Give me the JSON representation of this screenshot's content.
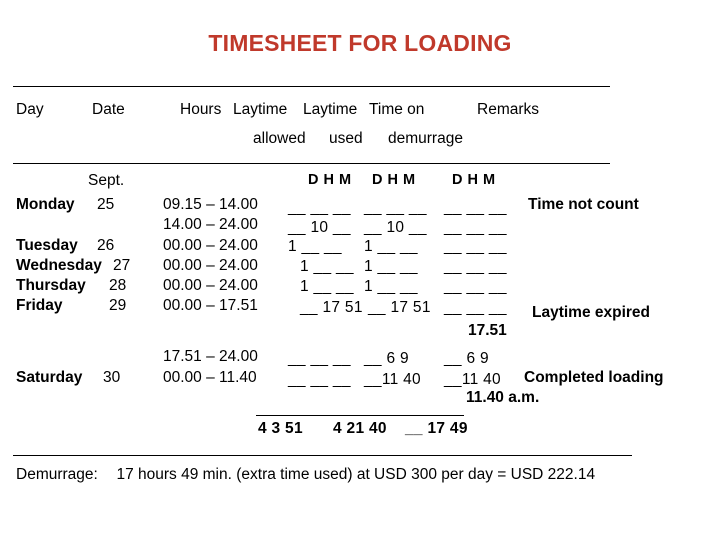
{
  "document": {
    "title": "TIMESHEET FOR LOADING",
    "title_color": "#C0392B"
  },
  "table": {
    "headers": {
      "day": "Day",
      "date": "Date",
      "hours": "Hours",
      "laytime_allowed_1": "Laytime",
      "laytime_allowed_2": "allowed",
      "laytime_used_1": "Laytime",
      "laytime_used_2": "used",
      "time_on_demurrage_1": "Time on",
      "time_on_demurrage_2": "demurrage",
      "remarks": "Remarks"
    },
    "month_label": "Sept.",
    "dhm_header": "D  H  M",
    "rows": [
      {
        "day": "Monday",
        "date": "25",
        "hours": "09.15 – 14.00",
        "laytime_allowed": "__  __  __",
        "laytime_used": "__  __  __",
        "time_on_demurrage": "__  __  __",
        "remarks": "Time not count"
      },
      {
        "day": "",
        "date": "",
        "hours": "14.00 – 24.00",
        "laytime_allowed": "__  10  __",
        "laytime_used": "__  10  __",
        "time_on_demurrage": "__  __  __",
        "remarks": ""
      },
      {
        "day": "Tuesday",
        "date": "26",
        "hours": "00.00 – 24.00",
        "laytime_allowed": "1  __  __",
        "laytime_used": "1  __  __",
        "time_on_demurrage": "__  __  __",
        "remarks": ""
      },
      {
        "day": "Wednesday",
        "date": "27",
        "hours": "00.00 – 24.00",
        "laytime_allowed": "1  __  __",
        "laytime_used": "1  __  __",
        "time_on_demurrage": "__  __  __",
        "remarks": ""
      },
      {
        "day": "Thursday",
        "date": "28",
        "hours": "00.00 – 24.00",
        "laytime_allowed": "1  __  __",
        "laytime_used": "1  __  __",
        "time_on_demurrage": "__  __  __",
        "remarks": ""
      },
      {
        "day": "Friday",
        "date": "29",
        "hours": "00.00 – 17.51",
        "laytime_allowed": "__  17  51",
        "laytime_used": "__  17  51",
        "time_on_demurrage": "__  __  __",
        "remarks": "Laytime expired"
      },
      {
        "day": "",
        "date": "",
        "hours": "17.51 – 24.00",
        "laytime_allowed": "__  __  __",
        "laytime_used": "__  6  9",
        "time_on_demurrage": "__  6  9",
        "remarks": ""
      },
      {
        "day": "Saturday",
        "date": "30",
        "hours": "00.00 – 11.40",
        "laytime_allowed": "__  __  __",
        "laytime_used": "__11  40",
        "time_on_demurrage": "__11  40",
        "remarks": "Completed loading"
      }
    ],
    "annotations": {
      "laytime_expired_time": "17.51",
      "completed_loading_time": "11.40 a.m."
    },
    "totals": {
      "laytime_allowed": "4   3   51",
      "laytime_used": "4  21 40",
      "time_on_demurrage": "__  17  49"
    }
  },
  "footer": {
    "label": "Demurrage:",
    "text": "17 hours 49 min. (extra time used) at USD 300 per day = USD 222.14"
  }
}
